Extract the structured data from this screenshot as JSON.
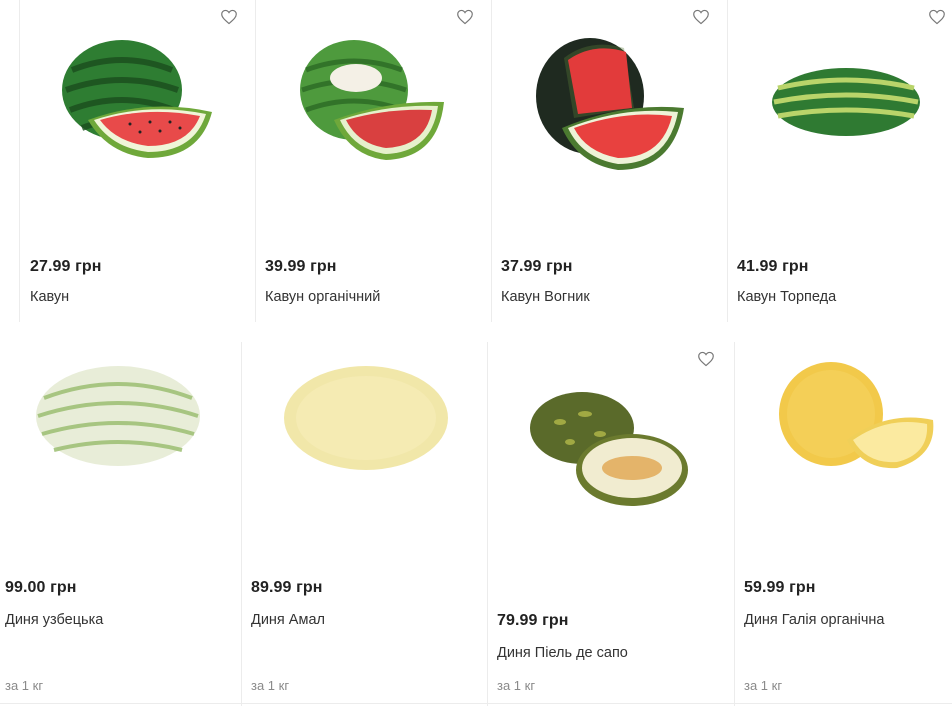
{
  "products_row1": [
    {
      "price": "27.99 грн",
      "name": "Кавун",
      "image": "watermelon-with-slice"
    },
    {
      "price": "39.99 грн",
      "name": "Кавун органічний",
      "image": "organic-watermelon-with-slice"
    },
    {
      "price": "37.99 грн",
      "name": "Кавун Вогник",
      "image": "dark-watermelon-with-slice"
    },
    {
      "price": "41.99 грн",
      "name": "Кавун Торпеда",
      "image": "oblong-watermelon"
    }
  ],
  "products_row2": [
    {
      "price": "99.00 грн",
      "name": "Диня узбецька",
      "unit": "за 1 кг",
      "image": "striped-melon"
    },
    {
      "price": "89.99 грн",
      "name": "Диня Амал",
      "unit": "за 1 кг",
      "image": "yellow-oval-melon"
    },
    {
      "price": "79.99 грн",
      "name": "Диня Піель де сапо",
      "unit": "за 1 кг",
      "image": "piel-de-sapo-melon-with-half"
    },
    {
      "price": "59.99 грн",
      "name": "Диня Галія органічна",
      "unit": "за 1 кг",
      "image": "galia-melon-with-slice"
    }
  ],
  "icons": {
    "favorite": "heart-outline-icon"
  },
  "colors": {
    "card_border": "#ececec",
    "price_text": "#222222",
    "unit_text": "#8a8a8a"
  }
}
